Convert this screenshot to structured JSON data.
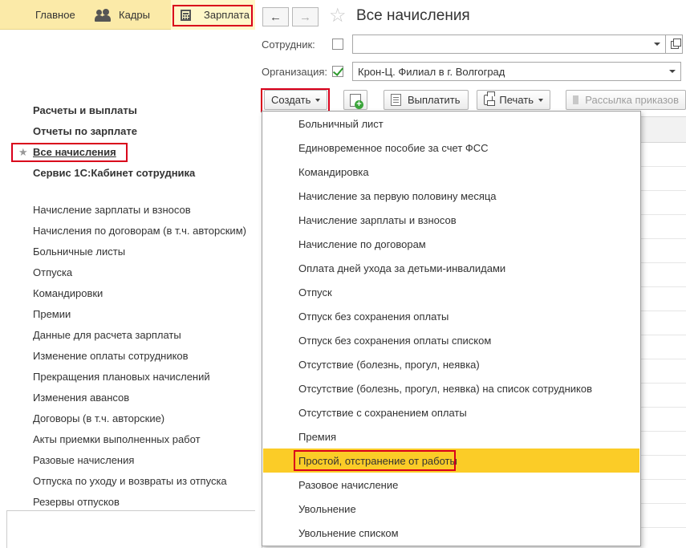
{
  "sections": {
    "main": "Главное",
    "staff": "Кадры",
    "salary": "Зарплата"
  },
  "nav": {
    "groups": [
      "Расчеты и выплаты",
      "Отчеты по зарплате",
      "Все начисления",
      "Сервис 1С:Кабинет сотрудника"
    ],
    "items": [
      "Начисление зарплаты и взносов",
      "Начисления по договорам (в т.ч. авторским)",
      "Больничные листы",
      "Отпуска",
      "Командировки",
      "Премии",
      "Данные для расчета зарплаты",
      "Изменение оплаты сотрудников",
      "Прекращения плановых начислений",
      "Изменения авансов",
      "Договоры (в т.ч. авторские)",
      "Акты приемки выполненных работ",
      "Разовые начисления",
      "Отпуска по уходу и возвраты из отпуска",
      "Резервы отпусков"
    ]
  },
  "form": {
    "back": "←",
    "forward": "→",
    "title": "Все начисления",
    "employee_label": "Сотрудник:",
    "employee_value": "",
    "organization_label": "Организация:",
    "organization_value": "Крон-Ц. Филиал в г. Волгоград"
  },
  "toolbar": {
    "create": "Создать",
    "pay": "Выплатить",
    "print": "Печать",
    "mailing": "Рассылка приказов"
  },
  "menu": {
    "items": [
      "Больничный лист",
      "Единовременное пособие за счет ФСС",
      "Командировка",
      "Начисление за первую половину месяца",
      "Начисление зарплаты и взносов",
      "Начисление по договорам",
      "Оплата дней ухода за детьми-инвалидами",
      "Отпуск",
      "Отпуск без сохранения оплаты",
      "Отпуск без сохранения оплаты списком",
      "Отсутствие (болезнь, прогул, неявка)",
      "Отсутствие (болезнь, прогул, неявка) на список сотрудников",
      "Отсутствие с сохранением оплаты",
      "Премия",
      "Простой, отстранение от работы",
      "Разовое начисление",
      "Увольнение",
      "Увольнение списком"
    ],
    "selected": "Простой, отстранение от работы"
  },
  "colors": {
    "section_bar": "#fbeaa8",
    "highlight": "#fbcc27",
    "annotation": "#d9001b",
    "check": "#2e9a2e"
  }
}
